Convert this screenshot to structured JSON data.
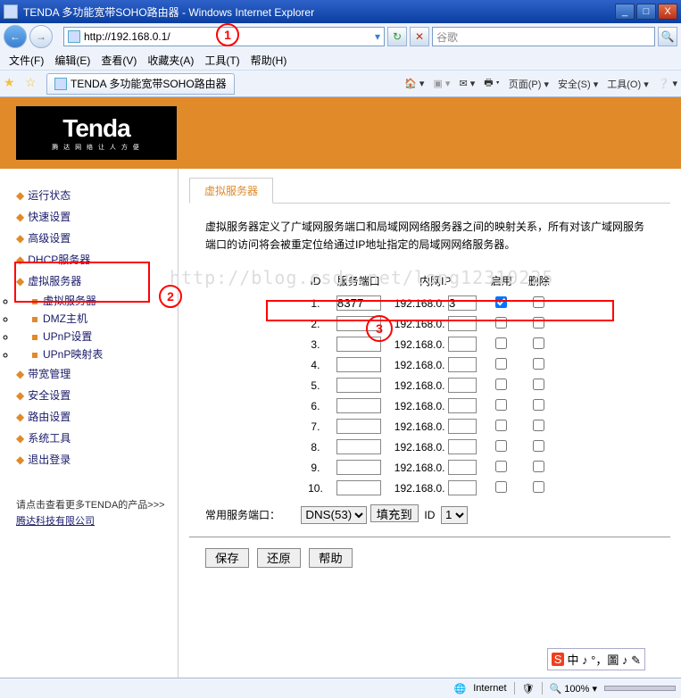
{
  "window": {
    "title": "TENDA 多功能宽带SOHO路由器 - Windows Internet Explorer"
  },
  "address": {
    "url": "http://192.168.0.1/"
  },
  "search": {
    "placeholder": "谷歌"
  },
  "menubar": [
    "文件(F)",
    "编辑(E)",
    "查看(V)",
    "收藏夹(A)",
    "工具(T)",
    "帮助(H)"
  ],
  "tab": {
    "title": "TENDA 多功能宽带SOHO路由器"
  },
  "cmdbar": [
    "▼",
    "",
    "打印",
    "▼",
    "页面(P)",
    "▼",
    "安全(S)",
    "▼",
    "工具(O)",
    "▼",
    "？",
    "▼"
  ],
  "logo": {
    "brand": "Tenda",
    "sub": "腾 达 网 络 让 人 方 便"
  },
  "sidebar": {
    "items": [
      "运行状态",
      "快速设置",
      "高级设置",
      "DHCP服务器",
      "虚拟服务器"
    ],
    "sub": [
      "虚拟服务器",
      "DMZ主机",
      "UPnP设置",
      "UPnP映射表"
    ],
    "items2": [
      "带宽管理",
      "安全设置",
      "路由设置",
      "系统工具",
      "退出登录"
    ],
    "promo1": "请点击查看更多TENDA的产品>>>",
    "promo2": "腾达科技有限公司"
  },
  "page": {
    "tab": "虚拟服务器",
    "desc": "虚拟服务器定义了广域网服务端口和局域网网络服务器之间的映射关系，所有对该广域网服务端口的访问将会被重定位给通过IP地址指定的局域网网络服务器。",
    "headers": {
      "id": "ID",
      "port": "服务端口",
      "ip": "内网IP",
      "enable": "启用",
      "del": "删除"
    },
    "ipPrefix": "192.168.0.",
    "rows": [
      {
        "n": "1.",
        "port": "8377",
        "ip": "3",
        "en": true
      },
      {
        "n": "2.",
        "port": "",
        "ip": "",
        "en": false
      },
      {
        "n": "3.",
        "port": "",
        "ip": "",
        "en": false
      },
      {
        "n": "4.",
        "port": "",
        "ip": "",
        "en": false
      },
      {
        "n": "5.",
        "port": "",
        "ip": "",
        "en": false
      },
      {
        "n": "6.",
        "port": "",
        "ip": "",
        "en": false
      },
      {
        "n": "7.",
        "port": "",
        "ip": "",
        "en": false
      },
      {
        "n": "8.",
        "port": "",
        "ip": "",
        "en": false
      },
      {
        "n": "9.",
        "port": "",
        "ip": "",
        "en": false
      },
      {
        "n": "10.",
        "port": "",
        "ip": "",
        "en": false
      }
    ],
    "common": {
      "label": "常用服务端口：",
      "service": "DNS(53)",
      "fill": "填充到",
      "idlabel": "ID",
      "idval": "1"
    },
    "buttons": {
      "save": "保存",
      "restore": "还原",
      "help": "帮助"
    }
  },
  "status": {
    "zone": "Internet",
    "zoom": "100%"
  },
  "annotations": {
    "a1": "1",
    "a2": "2",
    "a3": "3"
  },
  "watermark": "http://blog.csdn.net/long12310225",
  "ime": "中 ♪ °，圖 ♪ ✎"
}
